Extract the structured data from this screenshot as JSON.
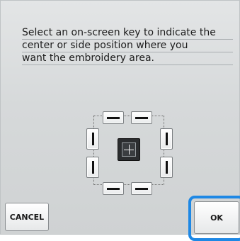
{
  "dialog": {
    "message_lines": [
      "Select an on-screen key to indicate the",
      "center or side position where you",
      "want the embroidery area."
    ]
  },
  "buttons": {
    "cancel": "CANCEL",
    "ok": "OK"
  },
  "colors": {
    "highlight": "#1e88e5",
    "panel": "#d8dbdc"
  },
  "keys": {
    "top_left": "bar-horizontal-icon",
    "top_right": "bar-horizontal-icon",
    "left_upper": "bar-vertical-icon",
    "left_lower": "bar-vertical-icon",
    "right_upper": "bar-vertical-icon",
    "right_lower": "bar-vertical-icon",
    "bottom_left": "bar-horizontal-icon",
    "bottom_right": "bar-horizontal-icon",
    "center": "crosshair-icon"
  }
}
